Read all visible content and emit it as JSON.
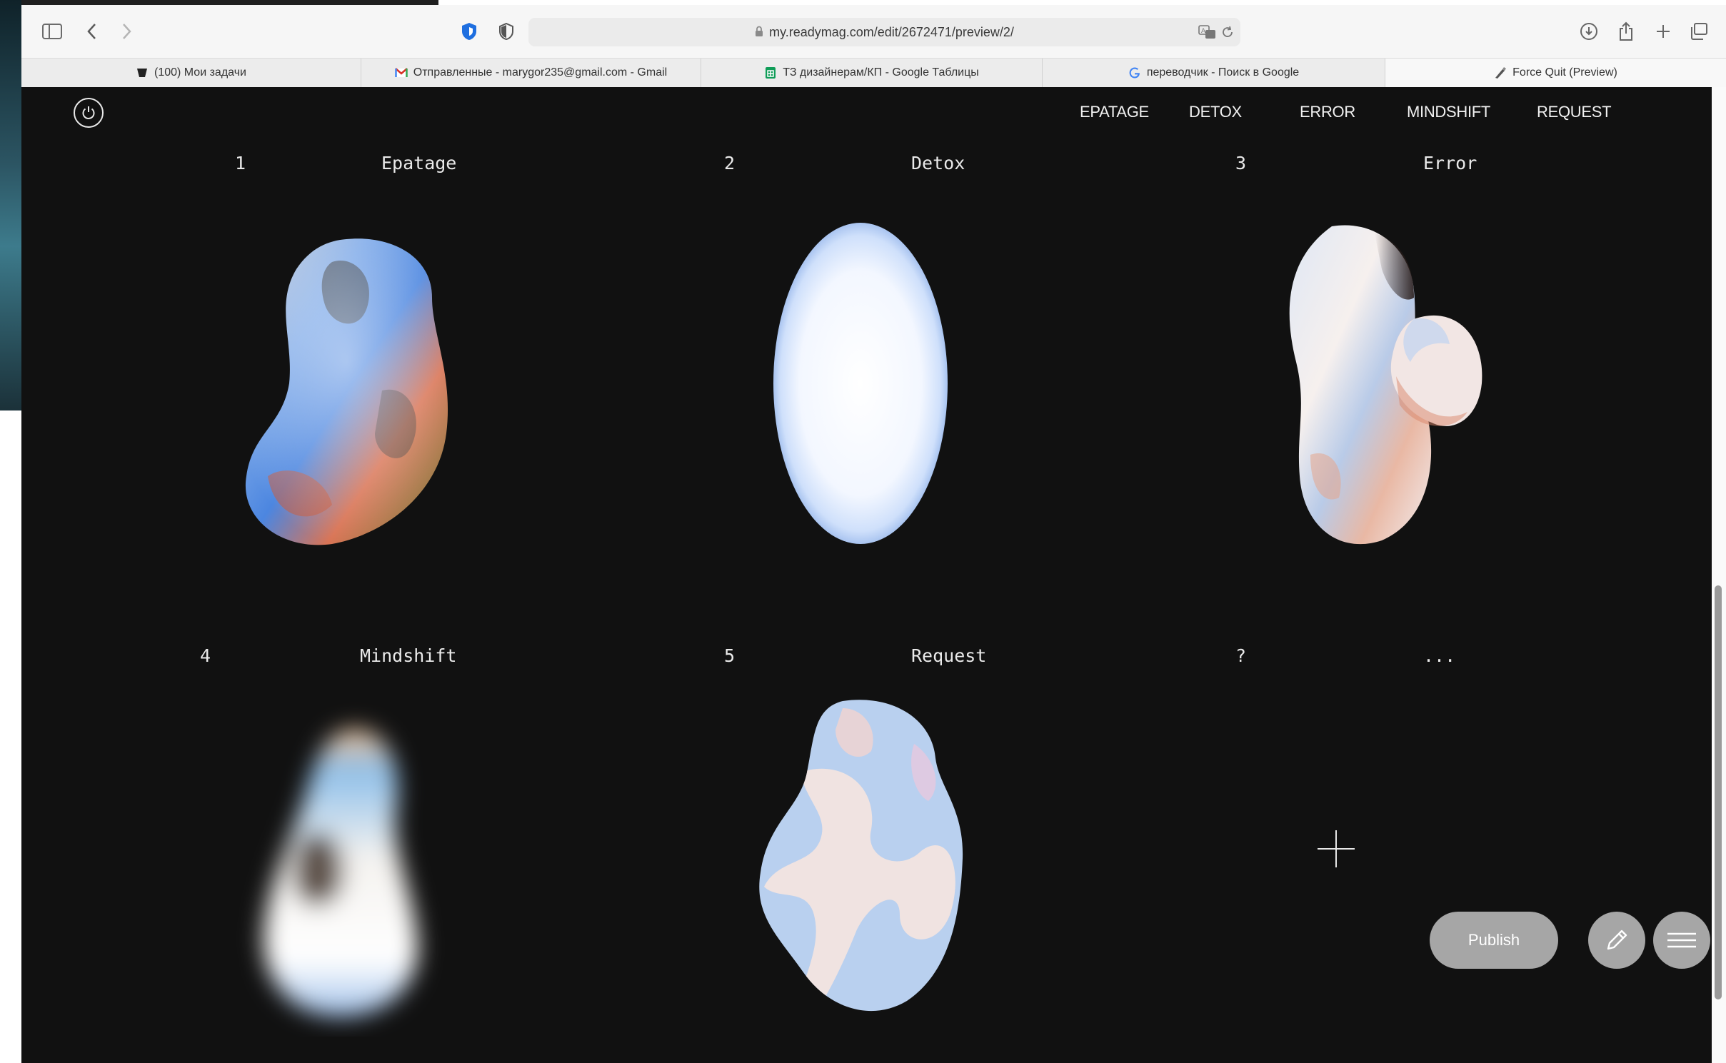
{
  "browser": {
    "url": "my.readymag.com/edit/2672471/preview/2/",
    "tabs": [
      {
        "label": "(100) Мои задачи",
        "icon": "task-favicon"
      },
      {
        "label": "Отправленные - marygor235@gmail.com - Gmail",
        "icon": "gmail-favicon"
      },
      {
        "label": "ТЗ дизайнерам/КП - Google Таблицы",
        "icon": "sheets-favicon"
      },
      {
        "label": "переводчик - Поиск в Google",
        "icon": "google-favicon"
      },
      {
        "label": "Force Quit (Preview)",
        "icon": "preview-favicon"
      }
    ]
  },
  "nav": {
    "items": [
      "EPATAGE",
      "DETOX",
      "ERROR",
      "MINDSHIFT",
      "REQUEST"
    ]
  },
  "projects": [
    {
      "num": "1",
      "name": "Epatage"
    },
    {
      "num": "2",
      "name": "Detox"
    },
    {
      "num": "3",
      "name": "Error"
    },
    {
      "num": "4",
      "name": "Mindshift"
    },
    {
      "num": "5",
      "name": "Request"
    },
    {
      "num": "?",
      "name": "..."
    }
  ],
  "actions": {
    "publish_label": "Publish"
  },
  "colors": {
    "page_bg": "#111111",
    "button_gray": "#a6a6a6"
  }
}
